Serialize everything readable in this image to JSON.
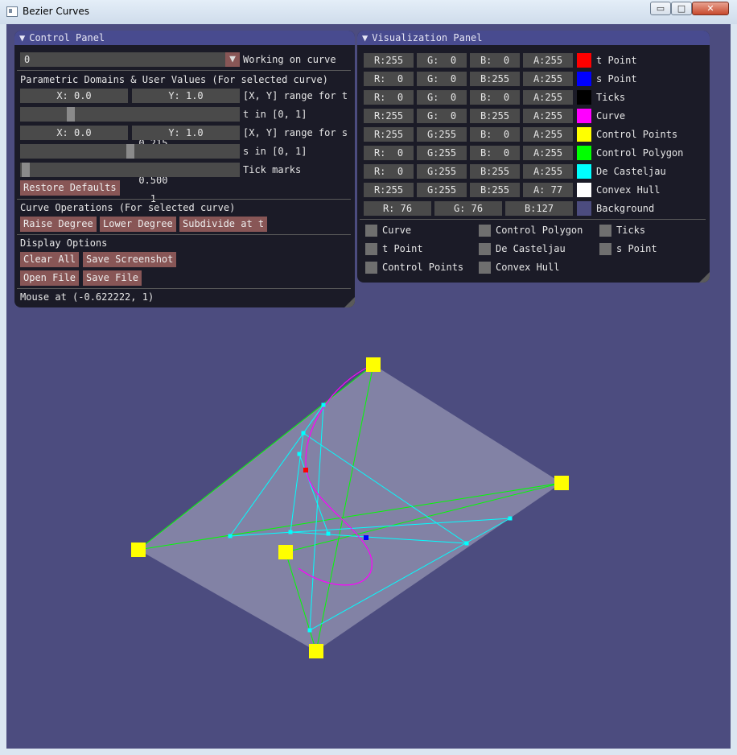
{
  "window": {
    "title": "Bezier Curves",
    "min_glyph": "▭",
    "max_glyph": "□",
    "close_glyph": "✕"
  },
  "control_panel": {
    "title": "Control Panel",
    "curve_select": {
      "value": "0",
      "label": "Working on curve"
    },
    "param_header": "Parametric Domains & User Values (For selected curve)",
    "t_range": {
      "x": "X: 0.0",
      "y": "Y: 1.0",
      "label": "[X, Y] range for t"
    },
    "t_slider": {
      "value": "0.215",
      "fraction": 0.215,
      "label": "t in [0, 1]"
    },
    "s_range": {
      "x": "X: 0.0",
      "y": "Y: 1.0",
      "label": "[X, Y] range for s"
    },
    "s_slider": {
      "value": "0.500",
      "fraction": 0.5,
      "label": "s in [0, 1]"
    },
    "tick_slider": {
      "value": "1",
      "label": "Tick marks"
    },
    "restore_button": "Restore Defaults",
    "curve_ops_header": "Curve Operations (For selected curve)",
    "raise_button": "Raise Degree",
    "lower_button": "Lower Degree",
    "subdivide_button": "Subdivide at t",
    "display_header": "Display Options",
    "clear_button": "Clear All",
    "screenshot_button": "Save Screenshot",
    "open_button": "Open File",
    "save_button": "Save File",
    "mouse_status": "Mouse at (-0.622222, 1)"
  },
  "visualization_panel": {
    "title": "Visualization Panel",
    "color_rows": [
      {
        "r": "R:255",
        "g": "G:  0",
        "b": "B:  0",
        "a": "A:255",
        "swatch": "#ff0000",
        "label": "t Point"
      },
      {
        "r": "R:  0",
        "g": "G:  0",
        "b": "B:255",
        "a": "A:255",
        "swatch": "#0000ff",
        "label": "s Point"
      },
      {
        "r": "R:  0",
        "g": "G:  0",
        "b": "B:  0",
        "a": "A:255",
        "swatch": "#000000",
        "label": "Ticks"
      },
      {
        "r": "R:255",
        "g": "G:  0",
        "b": "B:255",
        "a": "A:255",
        "swatch": "#ff00ff",
        "label": "Curve"
      },
      {
        "r": "R:255",
        "g": "G:255",
        "b": "B:  0",
        "a": "A:255",
        "swatch": "#ffff00",
        "label": "Control Points"
      },
      {
        "r": "R:  0",
        "g": "G:255",
        "b": "B:  0",
        "a": "A:255",
        "swatch": "#00ff00",
        "label": "Control Polygon"
      },
      {
        "r": "R:  0",
        "g": "G:255",
        "b": "B:255",
        "a": "A:255",
        "swatch": "#00ffff",
        "label": "De Casteljau"
      },
      {
        "r": "R:255",
        "g": "G:255",
        "b": "B:255",
        "a": "A: 77",
        "swatch": "#ffffff",
        "label": "Convex Hull"
      }
    ],
    "background_row": {
      "r": "R: 76",
      "g": "G: 76",
      "b": "B:127",
      "swatch": "#4c4c7f",
      "label": "Background"
    },
    "checkboxes": [
      {
        "label": "Curve"
      },
      {
        "label": "Control Polygon"
      },
      {
        "label": "Ticks"
      },
      {
        "label": "t Point"
      },
      {
        "label": "De Casteljau"
      },
      {
        "label": "s Point"
      },
      {
        "label": "Control Points"
      },
      {
        "label": "Convex Hull"
      }
    ]
  }
}
